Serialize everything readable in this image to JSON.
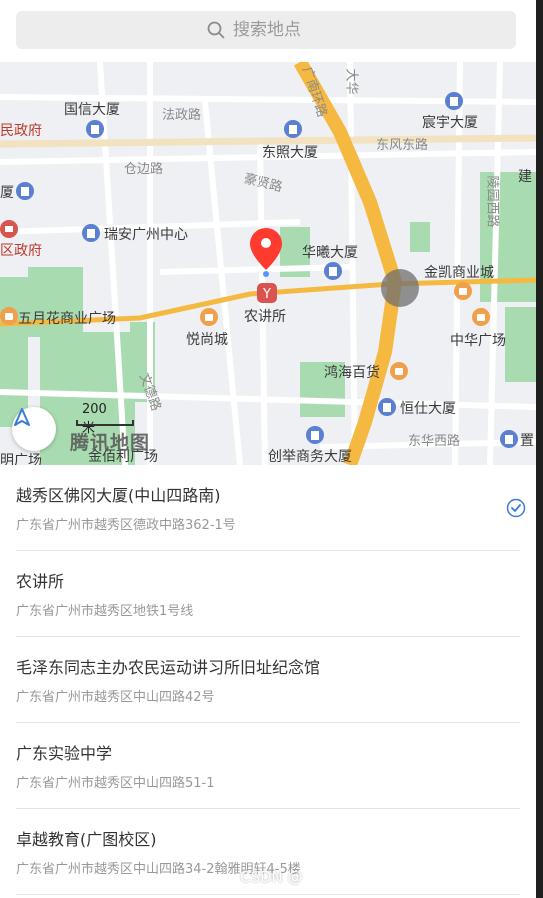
{
  "search": {
    "placeholder": "搜索地点",
    "icon": "search-icon"
  },
  "map": {
    "pois": {
      "guoxin": "国信大厦",
      "dongzhao": "东照大厦",
      "ruian": "瑞安广州中心",
      "huaxi": "华曦大厦",
      "jinkai": "金凯商业城",
      "wuyuehua": "五月花商业广场",
      "yuechang": "悦尚城",
      "nongjiangsuo": "农讲所",
      "zhonghua": "中华广场",
      "honghai": "鸿海百货",
      "hengshi": "恒仕大厦",
      "chuangju": "创举商务大厦",
      "jinbaili": "金佰利广场",
      "chenyu": "宸宇大厦",
      "minzhengfu": "民政府",
      "quzhengfu": "区政府",
      "jian": "建",
      "zhi": "置",
      "ming": "明广场",
      "sha": "厦"
    },
    "roads": {
      "fazheng": "法政路",
      "cangbian": "仓边路",
      "dongfeng": "东风东路",
      "haozhen": "豪贤路",
      "wende": "文德路",
      "donghua": "东华西路",
      "lingyuan": "陵园西路",
      "nandu": "广南环路",
      "dahua": "大华"
    },
    "scale_label": "200 米",
    "brand": "腾讯地图",
    "pin_color": "#ff3b30",
    "road_color": "#f5b840"
  },
  "places": [
    {
      "title": "越秀区佛冈大厦(中山四路南)",
      "address": "广东省广州市越秀区德政中路362-1号",
      "selected": true
    },
    {
      "title": "农讲所",
      "address": "广东省广州市越秀区地铁1号线",
      "selected": false
    },
    {
      "title": "毛泽东同志主办农民运动讲习所旧址纪念馆",
      "address": "广东省广州市越秀区中山四路42号",
      "selected": false
    },
    {
      "title": "广东实验中学",
      "address": "广东省广州市越秀区中山四路51-1",
      "selected": false
    },
    {
      "title": "卓越教育(广图校区)",
      "address": "广东省广州市越秀区中山四路34-2翰雅明轩4-5楼",
      "selected": false
    }
  ],
  "watermark": "CSDN @"
}
